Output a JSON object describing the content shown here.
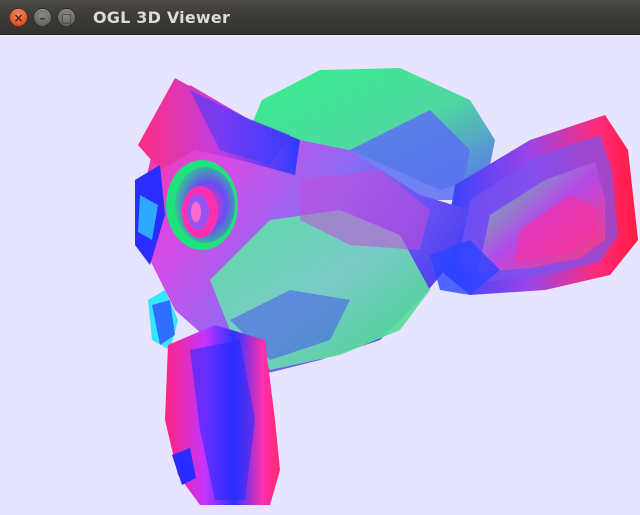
{
  "window": {
    "title": "OGL 3D Viewer",
    "controls": {
      "close_icon": "close-icon",
      "minimize_icon": "minimize-icon",
      "maximize_icon": "maximize-icon"
    }
  },
  "viewport": {
    "background_color": "#e6e4ff",
    "model": "suzanne-monkey-head",
    "shading": "normal-map"
  },
  "colors": {
    "titlebar": "#3c3b37",
    "close": "#e25a2e",
    "normal_red": "#ff1f6e",
    "normal_green": "#2ef08a",
    "normal_blue": "#2a2cff"
  }
}
